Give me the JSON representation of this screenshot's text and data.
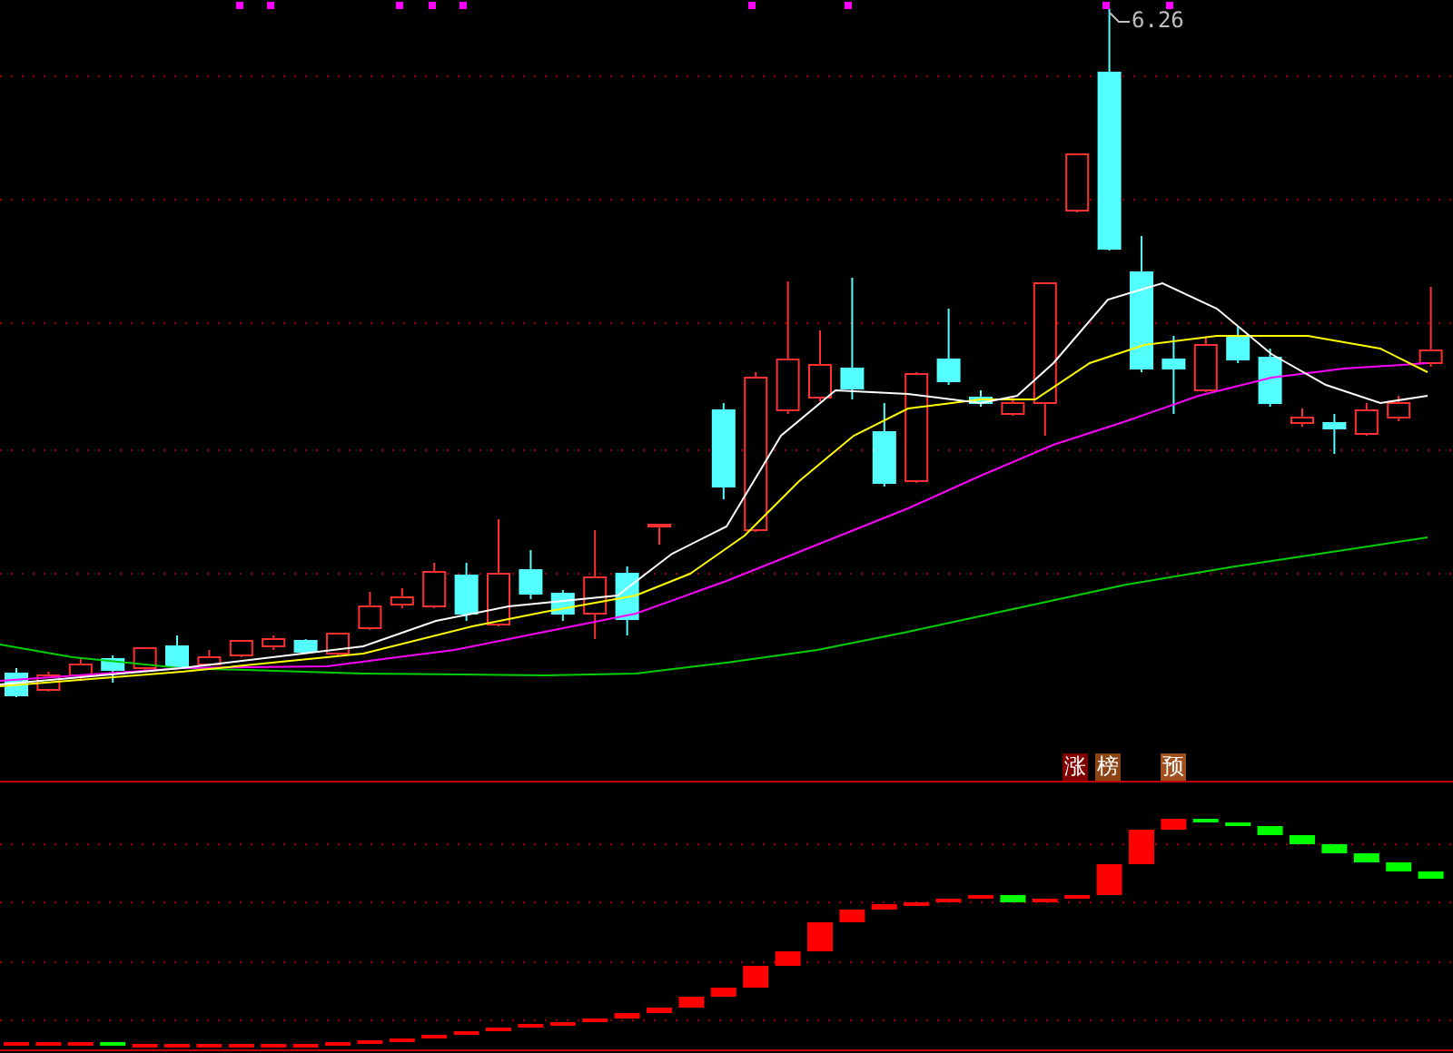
{
  "price_chart": {
    "high_label": "6.26"
  },
  "indicator": {
    "tags": [
      {
        "label": "涨",
        "color": "#800000"
      },
      {
        "label": "榜",
        "color": "#8b4513"
      },
      {
        "label": "预",
        "color": "#a0501c"
      }
    ]
  }
}
